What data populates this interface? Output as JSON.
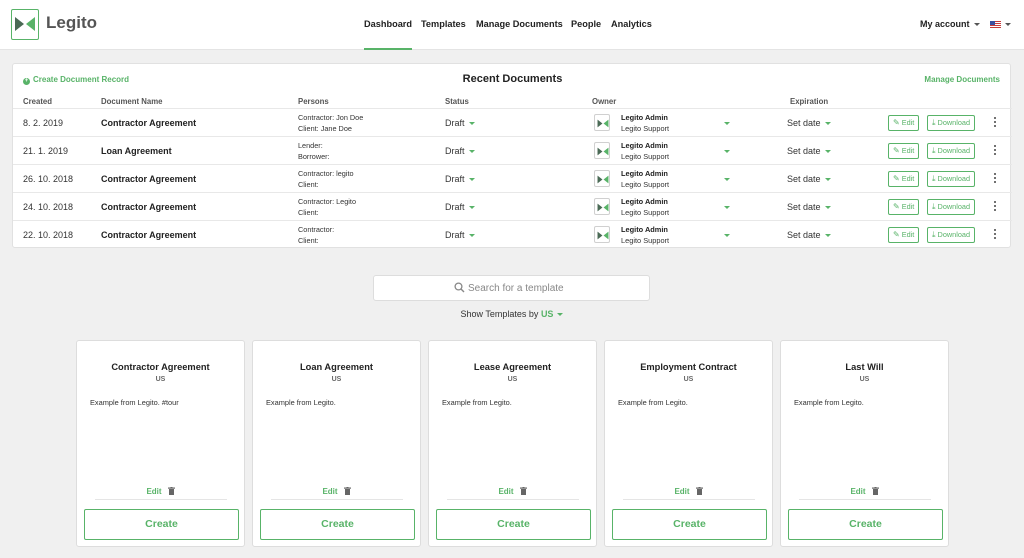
{
  "app": {
    "name": "Legito",
    "brand_color": "#58b368"
  },
  "nav": {
    "items": [
      {
        "label": "Dashboard",
        "active": true
      },
      {
        "label": "Templates",
        "active": false
      },
      {
        "label": "Manage Documents",
        "active": false
      },
      {
        "label": "People",
        "active": false
      },
      {
        "label": "Analytics",
        "active": false
      }
    ],
    "account_label": "My account",
    "language_flag": "us-flag-icon"
  },
  "recent": {
    "title": "Recent Documents",
    "create_record_label": "Create Document Record",
    "manage_label": "Manage Documents",
    "columns": [
      "Created",
      "Document Name",
      "Persons",
      "Status",
      "Owner",
      "Expiration"
    ],
    "rows": [
      {
        "created": "8. 2. 2019",
        "name": "Contractor Agreement",
        "person1": "Contractor: Jon Doe",
        "person2": "Client: Jane Doe",
        "status": "Draft",
        "owner_name": "Legito Admin",
        "owner_org": "Legito Support",
        "expiration": "Set date"
      },
      {
        "created": "21. 1. 2019",
        "name": "Loan Agreement",
        "person1": "Lender:",
        "person2": "Borrower:",
        "status": "Draft",
        "owner_name": "Legito Admin",
        "owner_org": "Legito Support",
        "expiration": "Set date"
      },
      {
        "created": "26. 10. 2018",
        "name": "Contractor Agreement",
        "person1": "Contractor: legito",
        "person2": "Client:",
        "status": "Draft",
        "owner_name": "Legito Admin",
        "owner_org": "Legito Support",
        "expiration": "Set date"
      },
      {
        "created": "24. 10. 2018",
        "name": "Contractor Agreement",
        "person1": "Contractor: Legito",
        "person2": "Client:",
        "status": "Draft",
        "owner_name": "Legito Admin",
        "owner_org": "Legito Support",
        "expiration": "Set date"
      },
      {
        "created": "22. 10. 2018",
        "name": "Contractor Agreement",
        "person1": "Contractor:",
        "person2": "Client:",
        "status": "Draft",
        "owner_name": "Legito Admin",
        "owner_org": "Legito Support",
        "expiration": "Set date"
      }
    ],
    "edit_label": "Edit",
    "download_label": "Download"
  },
  "search": {
    "placeholder": "Search for a template"
  },
  "filter": {
    "prefix": "Show Templates by",
    "value": "US"
  },
  "templates": [
    {
      "title": "Contractor Agreement",
      "region": "US",
      "description": "Example from Legito. #tour"
    },
    {
      "title": "Loan Agreement",
      "region": "US",
      "description": "Example from Legito."
    },
    {
      "title": "Lease Agreement",
      "region": "US",
      "description": "Example from Legito."
    },
    {
      "title": "Employment Contract",
      "region": "US",
      "description": "Example from Legito."
    },
    {
      "title": "Last Will",
      "region": "US",
      "description": "Example from Legito."
    }
  ],
  "card_labels": {
    "edit": "Edit",
    "create": "Create"
  }
}
